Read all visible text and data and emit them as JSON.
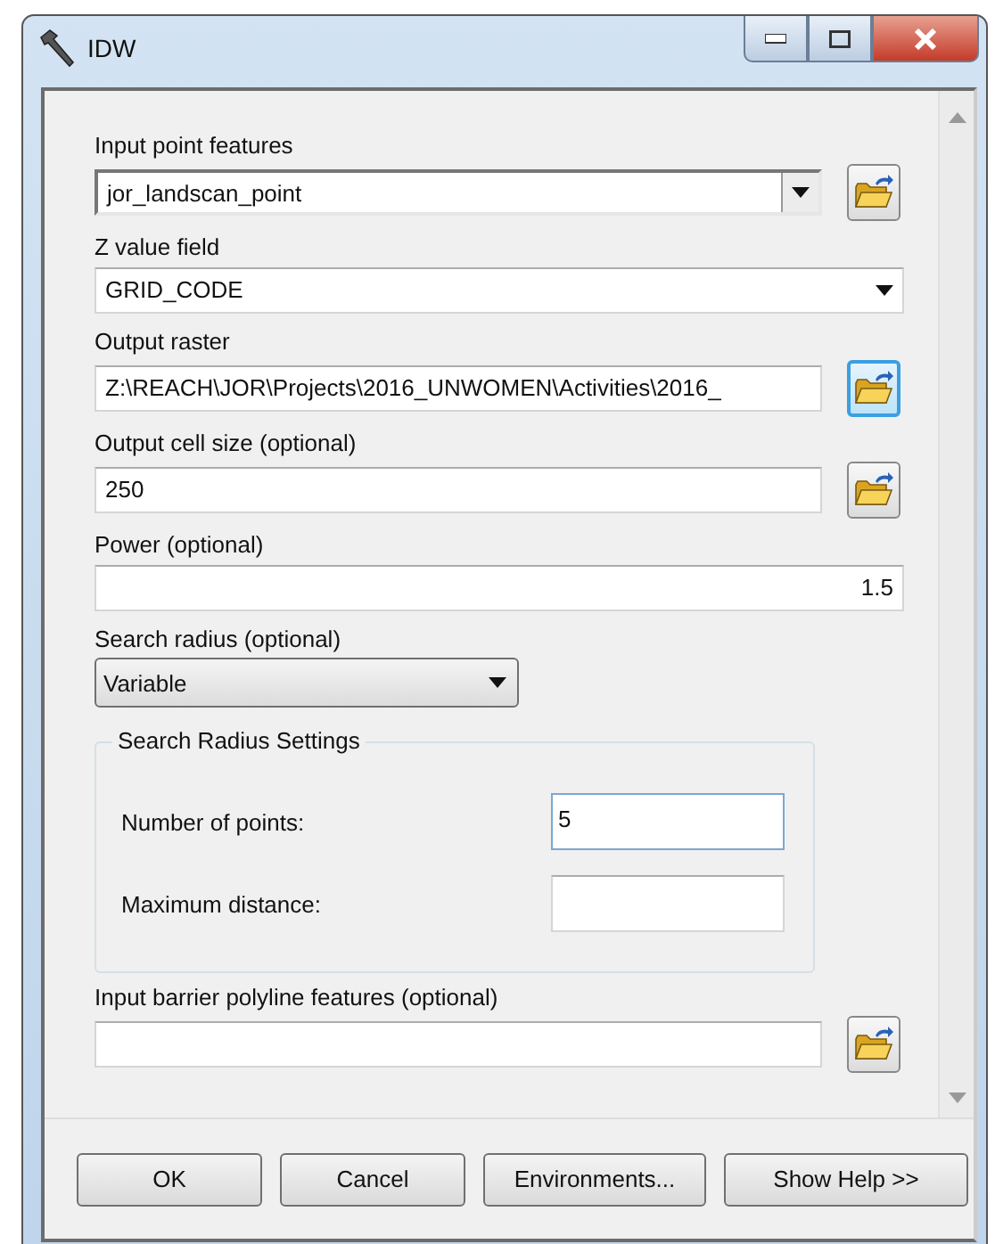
{
  "window": {
    "title": "IDW"
  },
  "parameters": [
    {
      "kind": "combo",
      "label": "Input point features",
      "value": "jor_landscan_point",
      "browse": true,
      "focused": false
    },
    {
      "kind": "dropdown",
      "label": "Z value field",
      "value": "GRID_CODE"
    },
    {
      "kind": "text",
      "label": "Output raster",
      "value": "Z:\\REACH\\JOR\\Projects\\2016_UNWOMEN\\Activities\\2016_",
      "browse": true,
      "focused": true
    },
    {
      "kind": "text",
      "label": "Output cell size (optional)",
      "value": "250",
      "browse": true,
      "focused": false
    },
    {
      "kind": "number",
      "label": "Power (optional)",
      "value": "1.5"
    },
    {
      "kind": "select",
      "label": "Search radius (optional)",
      "value": "Variable"
    },
    {
      "kind": "group",
      "title": "Search Radius Settings",
      "fields": [
        {
          "label": "Number of points:",
          "value": "5",
          "focused": true
        },
        {
          "label": "Maximum distance:",
          "focused": false
        }
      ]
    },
    {
      "kind": "text",
      "label": "Input barrier polyline features (optional)",
      "browse": true,
      "focused": false
    }
  ],
  "buttons": [
    "OK",
    "Cancel",
    "Environments...",
    "Show Help >>"
  ]
}
